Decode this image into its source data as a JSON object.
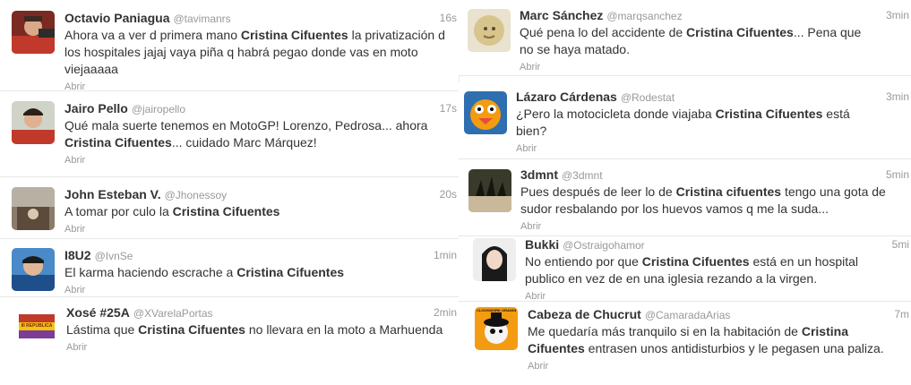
{
  "left_column": [
    {
      "name": "Octavio Paniagua",
      "handle": "@tavimanrs",
      "time": "16s",
      "text": [
        {
          "t": "Ahora va a ver d primera mano "
        },
        {
          "t": "Cristina Cifuentes",
          "b": true
        },
        {
          "t": " la privatización d los hospitales jajaj vaya piña q habrá pegao donde vas en moto viejaaaaa"
        }
      ],
      "action": "Abrir"
    },
    {
      "name": "Jairo Pello",
      "handle": "@jairopello",
      "time": "17s",
      "text": [
        {
          "t": "Qué mala suerte tenemos en MotoGP! Lorenzo, Pedrosa... ahora "
        },
        {
          "t": "Cristina Cifuentes",
          "b": true
        },
        {
          "t": "... cuidado Marc Márquez!"
        }
      ],
      "action": "Abrir"
    },
    {
      "name": "John Esteban V.",
      "handle": "@Jhonessoy",
      "time": "20s",
      "text": [
        {
          "t": "A tomar por culo la "
        },
        {
          "t": "Cristina Cifuentes",
          "b": true
        }
      ],
      "action": "Abrir"
    },
    {
      "name": "I8U2",
      "handle": "@IvnSe",
      "time": "1min",
      "text": [
        {
          "t": "El karma haciendo escrache a "
        },
        {
          "t": "Cristina Cifuentes",
          "b": true
        }
      ],
      "action": "Abrir"
    },
    {
      "name": "Xosé #25A",
      "handle": "@XVarelaPortas",
      "time": "2min",
      "text": [
        {
          "t": "Lástima que "
        },
        {
          "t": "Cristina Cifuentes",
          "b": true
        },
        {
          "t": " no llevara en la moto a Marhuenda"
        }
      ],
      "action": "Abrir",
      "avatar_label": "III REPÚBLICA"
    }
  ],
  "right_column": [
    {
      "name": "Marc Sánchez",
      "handle": "@marqsanchez",
      "time": "3min",
      "text": [
        {
          "t": "Qué pena lo del accidente de "
        },
        {
          "t": "Cristina Cifuentes",
          "b": true
        },
        {
          "t": "... Pena que no se haya matado."
        }
      ],
      "action": "Abrir"
    },
    {
      "name": "Lázaro Cárdenas",
      "handle": "@Rodestat",
      "time": "3min",
      "text": [
        {
          "t": "¿Pero la motocicleta donde viajaba "
        },
        {
          "t": "Cristina Cifuentes",
          "b": true
        },
        {
          "t": " está bien?"
        }
      ],
      "action": "Abrir"
    },
    {
      "name": "3dmnt",
      "handle": "@3dmnt",
      "time": "5min",
      "text": [
        {
          "t": "Pues después de leer lo de "
        },
        {
          "t": "Cristina cifuentes",
          "b": true
        },
        {
          "t": " tengo una gota de sudor resbalando por los huevos vamos q me la suda..."
        }
      ],
      "action": "Abrir"
    },
    {
      "name": "Bukki",
      "handle": "@Ostraigohamor",
      "time": "5mi",
      "text": [
        {
          "t": "No entiendo por que "
        },
        {
          "t": "Cristina Cifuentes",
          "b": true
        },
        {
          "t": " está en un hospital publico en vez de en una iglesia rezando a la virgen."
        }
      ],
      "action": "Abrir"
    },
    {
      "name": "Cabeza de Chucrut",
      "handle": "@CamaradaArias",
      "time": "7m",
      "text": [
        {
          "t": "Me quedaría más tranquilo si en la habitación de "
        },
        {
          "t": "Cristina Cifuentes",
          "b": true
        },
        {
          "t": " entrasen unos antidisturbios y le pegasen una paliza."
        }
      ],
      "action": "Abrir",
      "avatar_label": "CLOCKWORK ORANGE"
    }
  ]
}
